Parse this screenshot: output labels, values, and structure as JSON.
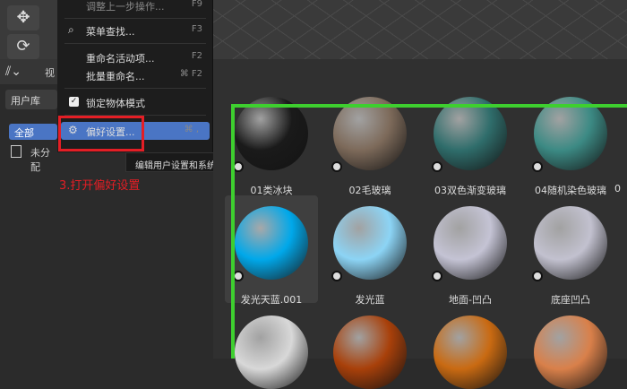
{
  "menu": {
    "items": [
      {
        "label": "调整上一步操作...",
        "shortcut": "F9"
      },
      {
        "label": "菜单查找...",
        "shortcut": "F3"
      },
      {
        "label": "重命名活动项...",
        "shortcut": "F2"
      },
      {
        "label": "批量重命名...",
        "shortcut": "⌘ F2"
      },
      {
        "label": "锁定物体模式",
        "shortcut": ""
      },
      {
        "label": "偏好设置...",
        "shortcut": "⌘ ,"
      }
    ]
  },
  "tooltip": "编辑用户设置和系统设定.",
  "annotation": "3.打开偏好设置",
  "left_panel": {
    "view_label": "视",
    "library_label": "用户库",
    "all_label": "全部",
    "unassigned_label": "未分配"
  },
  "materials": [
    {
      "label": "01类冰块",
      "color": "#1a1a1a"
    },
    {
      "label": "02毛玻璃",
      "color": "#7d6a5a"
    },
    {
      "label": "03双色渐变玻璃",
      "color": "#2f6d6b"
    },
    {
      "label": "04随机染色玻璃",
      "color": "#3c8a84"
    },
    {
      "label": "发光天蓝.001",
      "color": "#00a8ea"
    },
    {
      "label": "发光蓝",
      "color": "#8cd4f5"
    },
    {
      "label": "地面-凹凸",
      "color": "#c4c3d4"
    },
    {
      "label": "底座凹凸",
      "color": "#c2c1cf"
    },
    {
      "label": "",
      "color": "#d8d8d8"
    },
    {
      "label": "",
      "color": "#a8400a"
    },
    {
      "label": "",
      "color": "#c96a12"
    },
    {
      "label": "",
      "color": "#d9804a"
    }
  ],
  "partial_label": "0"
}
